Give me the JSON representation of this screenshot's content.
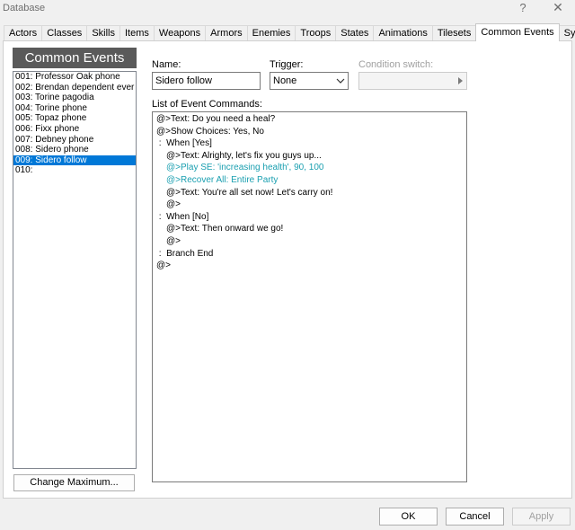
{
  "window": {
    "title": "Database",
    "help": "?",
    "close": "✕"
  },
  "tabs": [
    {
      "label": "Actors"
    },
    {
      "label": "Classes"
    },
    {
      "label": "Skills"
    },
    {
      "label": "Items"
    },
    {
      "label": "Weapons"
    },
    {
      "label": "Armors"
    },
    {
      "label": "Enemies"
    },
    {
      "label": "Troops"
    },
    {
      "label": "States"
    },
    {
      "label": "Animations"
    },
    {
      "label": "Tilesets"
    },
    {
      "label": "Common Events",
      "active": true
    },
    {
      "label": "System"
    }
  ],
  "left": {
    "header": "Common Events",
    "items": [
      {
        "label": "001: Professor Oak phone"
      },
      {
        "label": "002: Brendan dependent ever"
      },
      {
        "label": "003: Torine pagodia"
      },
      {
        "label": "004: Torine phone"
      },
      {
        "label": "005: Topaz phone"
      },
      {
        "label": "006: Fixx phone"
      },
      {
        "label": "007: Debney phone"
      },
      {
        "label": "008: Sidero phone"
      },
      {
        "label": "009: Sidero follow",
        "selected": true
      },
      {
        "label": "010:"
      }
    ],
    "change_max": "Change Maximum..."
  },
  "form": {
    "name_label": "Name:",
    "name_value": "Sidero follow",
    "trigger_label": "Trigger:",
    "trigger_value": "None",
    "condition_label": "Condition switch:",
    "commands_label": "List of Event Commands:"
  },
  "commands": [
    {
      "text": "@>Text: Do you need a heal?",
      "indent": 0
    },
    {
      "text": "@>Show Choices: Yes, No",
      "indent": 0
    },
    {
      "text": " :  When [Yes]",
      "indent": 0
    },
    {
      "text": "@>Text: Alrighty, let's fix you guys up...",
      "indent": 1
    },
    {
      "text": "@>Play SE: 'increasing health', 90, 100",
      "indent": 1,
      "kind": "se"
    },
    {
      "text": "@>Recover All: Entire Party",
      "indent": 1,
      "kind": "se"
    },
    {
      "text": "@>Text: You're all set now! Let's carry on!",
      "indent": 1
    },
    {
      "text": "@>",
      "indent": 1
    },
    {
      "text": " :  When [No]",
      "indent": 0
    },
    {
      "text": "@>Text: Then onward we go!",
      "indent": 1
    },
    {
      "text": "@>",
      "indent": 1
    },
    {
      "text": " :  Branch End",
      "indent": 0
    },
    {
      "text": "@>",
      "indent": 0
    }
  ],
  "buttons": {
    "ok": "OK",
    "cancel": "Cancel",
    "apply": "Apply"
  },
  "colors": {
    "selection": "#0078d7",
    "header_bg": "#5a5a5a",
    "se_text": "#1a9fb0"
  }
}
